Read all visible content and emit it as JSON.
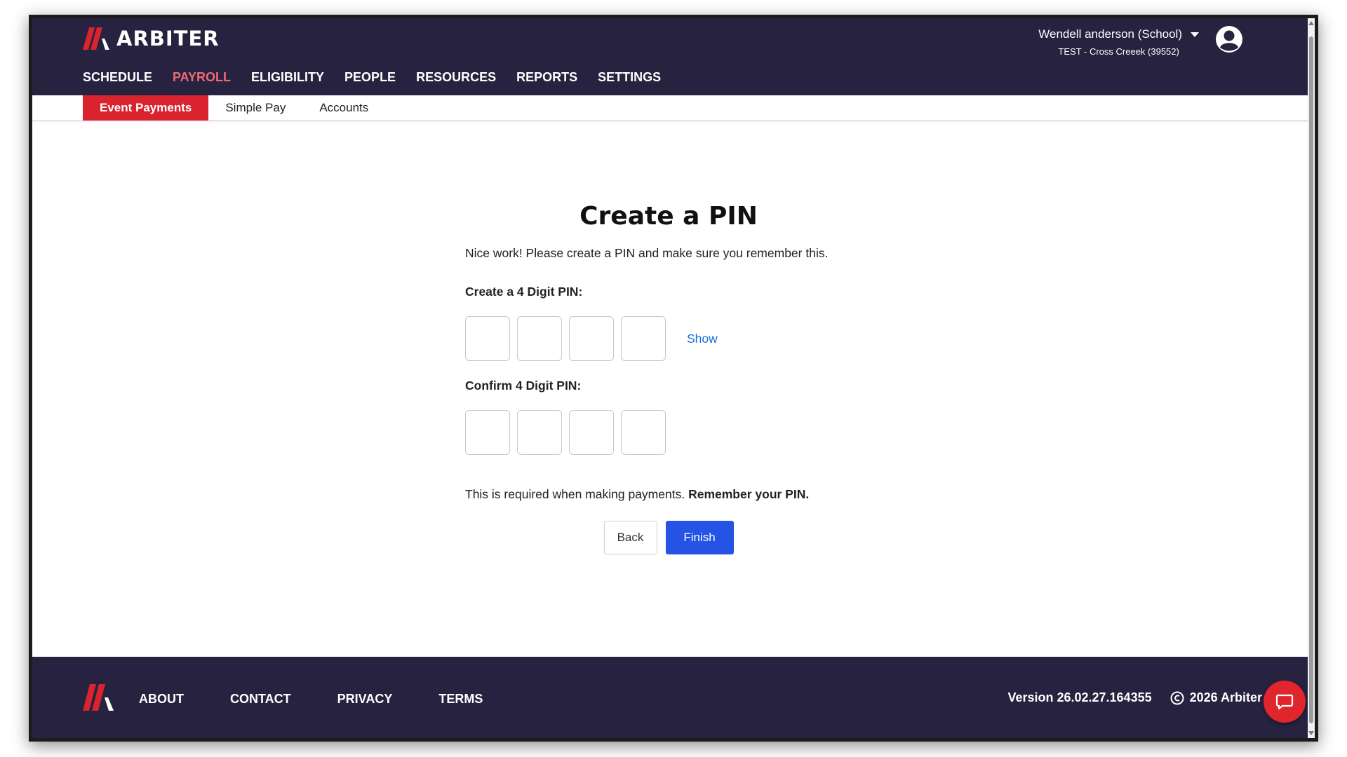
{
  "header": {
    "logo_text": "ARBITER",
    "nav": [
      {
        "label": "SCHEDULE",
        "active": false
      },
      {
        "label": "PAYROLL",
        "active": true
      },
      {
        "label": "ELIGIBILITY",
        "active": false
      },
      {
        "label": "PEOPLE",
        "active": false
      },
      {
        "label": "RESOURCES",
        "active": false
      },
      {
        "label": "REPORTS",
        "active": false
      },
      {
        "label": "SETTINGS",
        "active": false
      }
    ],
    "user_name": "Wendell anderson (School)",
    "org_name": "TEST - Cross Creeek (39552)"
  },
  "subnav": {
    "tabs": [
      {
        "label": "Event Payments",
        "active": true
      },
      {
        "label": "Simple Pay",
        "active": false
      },
      {
        "label": "Accounts",
        "active": false
      }
    ]
  },
  "main": {
    "title": "Create a PIN",
    "intro": "Nice work! Please create a PIN and make sure you remember this.",
    "create_label": "Create a 4 Digit PIN:",
    "show_label": "Show",
    "confirm_label": "Confirm 4 Digit PIN:",
    "note_prefix": "This is required when making payments.",
    "note_bold": "Remember your PIN.",
    "back_label": "Back",
    "finish_label": "Finish"
  },
  "footer": {
    "links": [
      "ABOUT",
      "CONTACT",
      "PRIVACY",
      "TERMS"
    ],
    "version": "Version 26.02.27.164355",
    "copyright": "2026 Arbiter"
  },
  "colors": {
    "header_bg": "#26223f",
    "brand_red": "#d9232e",
    "active_nav": "#f06a73",
    "primary_button": "#2453e6",
    "link_blue": "#1c6fd6"
  },
  "icons": {
    "logo": "arbiter-logo-icon",
    "user_menu": "chevron-down-icon",
    "avatar": "user-avatar-icon",
    "copyright": "copyright-icon",
    "chat": "chat-icon"
  }
}
